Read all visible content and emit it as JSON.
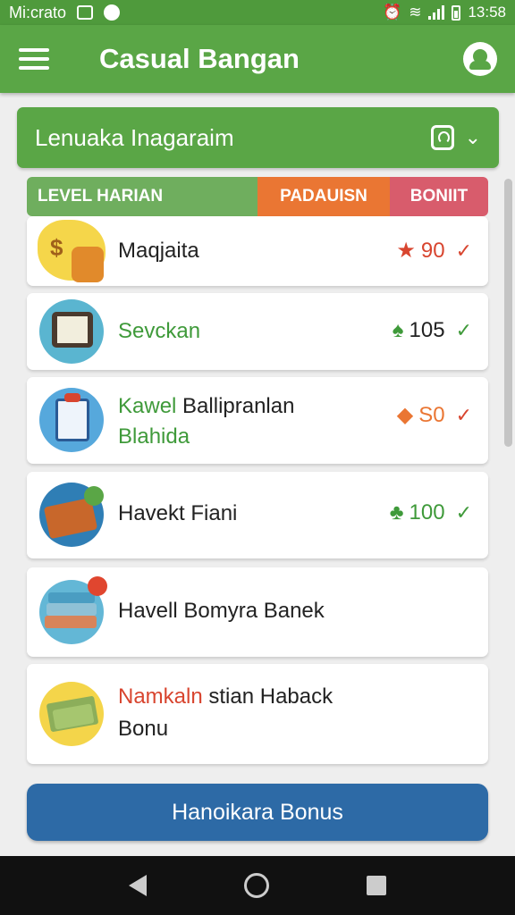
{
  "status_bar": {
    "carrier": "Mi:crato",
    "time": "13:58"
  },
  "app_bar": {
    "title": "Casual Bangan",
    "menu_icon": "menu-icon",
    "profile_icon": "profile-icon"
  },
  "dropdown": {
    "label": "Lenuaka Inagaraim"
  },
  "table_header": {
    "col1": "LEVEL HARIAN",
    "col2": "PADAUISN",
    "col3": "BONIIT"
  },
  "tasks": [
    {
      "title": "Maqjaita",
      "reward": "90",
      "icon": "money-bag-icon",
      "color": "#d8452f"
    },
    {
      "title": "Sevckan",
      "reward": "105",
      "icon": "tablet-icon",
      "color": "#3f9a3a"
    },
    {
      "title_a": "Kawel",
      "title_b": "Ballipranlan",
      "subtitle": "Blahida",
      "reward": "S0",
      "icon": "clipboard-icon",
      "color": "#ea7633"
    },
    {
      "title": "Havekt Fiani",
      "reward": "100",
      "icon": "book-icon",
      "color": "#3f9a3a"
    },
    {
      "title": "Havell Bomyra Banek",
      "icon": "books-icon"
    },
    {
      "title_a": "Namkaln",
      "title_b": "stian Haback",
      "line2": "Bonu",
      "icon": "cash-icon"
    }
  ],
  "bonus_button": {
    "label": "Hanoikara Bonus"
  },
  "colors": {
    "green": "#5aa646",
    "orange": "#ea7633",
    "pink": "#d85c6c",
    "blue": "#2d6aa6"
  }
}
